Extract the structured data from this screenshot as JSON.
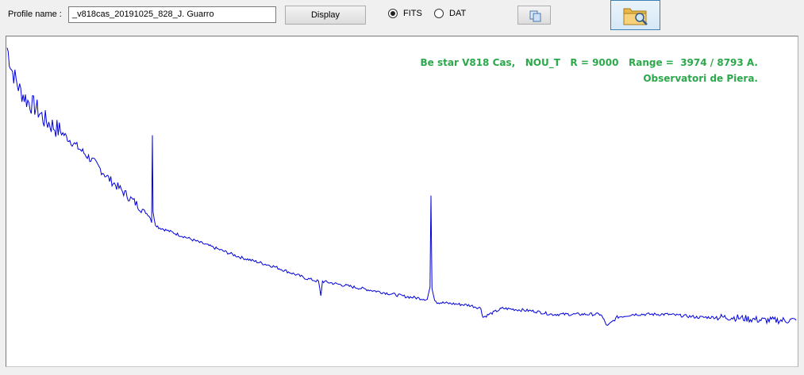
{
  "toolbar": {
    "profile_label": "Profile name :",
    "profile_value": "_v818cas_20191025_828_J. Guarro",
    "display_label": "Display",
    "format_options": [
      {
        "label": "FITS",
        "selected": true
      },
      {
        "label": "DAT",
        "selected": false
      }
    ],
    "copy_icon": "copy-icon",
    "open_icon": "folder-search-icon"
  },
  "plot": {
    "annotation_line1": "Be star V818 Cas,   NOU_T   R = 9000   Range =  3974 / 8793 A.",
    "annotation_line2": "Observatori de Piera.",
    "line_color": "#0000dd",
    "annotation_color": "#2aa84a"
  },
  "chart_data": {
    "type": "line",
    "xlim": [
      3974,
      8793
    ],
    "series": [
      {
        "x": [
          3974,
          4000,
          4050,
          4100,
          4150,
          4200,
          4300,
          4400,
          4500,
          4600,
          4700,
          4800,
          4840,
          4857,
          4861,
          4865,
          4880,
          4900,
          5000,
          5200,
          5400,
          5600,
          5800,
          5876,
          5890,
          5900,
          6000,
          6200,
          6400,
          6540,
          6557,
          6563,
          6569,
          6585,
          6600,
          6800,
          6868,
          6880,
          7000,
          7200,
          7300,
          7400,
          7600,
          7640,
          7700,
          7800,
          8000,
          8200,
          8400,
          8600,
          8700,
          8793
        ],
        "y": [
          1.0,
          0.93,
          0.86,
          0.82,
          0.8,
          0.76,
          0.72,
          0.67,
          0.62,
          0.56,
          0.51,
          0.46,
          0.44,
          0.42,
          0.71,
          0.45,
          0.41,
          0.4,
          0.38,
          0.34,
          0.3,
          0.27,
          0.23,
          0.22,
          0.17,
          0.22,
          0.21,
          0.19,
          0.17,
          0.16,
          0.2,
          0.51,
          0.2,
          0.16,
          0.15,
          0.14,
          0.13,
          0.1,
          0.13,
          0.12,
          0.11,
          0.11,
          0.11,
          0.07,
          0.1,
          0.11,
          0.11,
          0.1,
          0.1,
          0.09,
          0.09,
          0.09
        ]
      }
    ]
  }
}
